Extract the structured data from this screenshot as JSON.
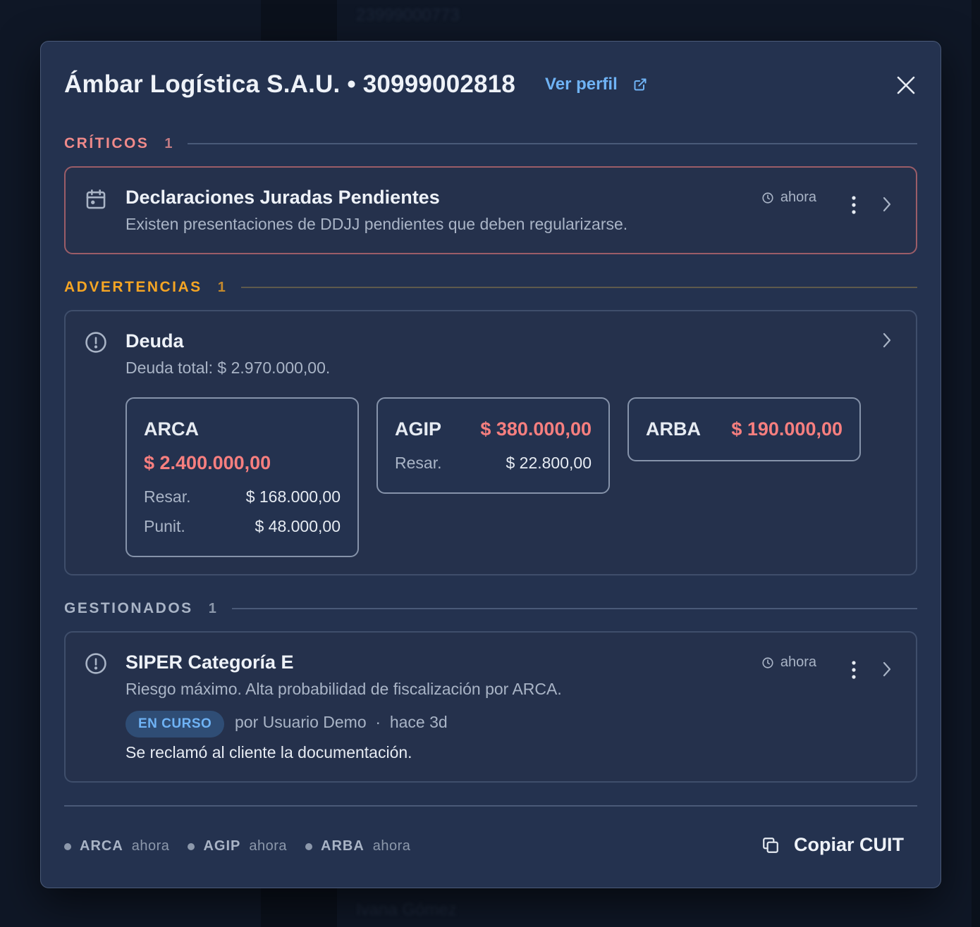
{
  "background": {
    "faint_number": "23999000773",
    "faint_name": "Ivana Gómez"
  },
  "modal": {
    "title": "Ámbar Logística S.A.U. • 30999002818",
    "profile_link": "Ver perfil"
  },
  "sections": {
    "criticos": {
      "label": "CRÍTICOS",
      "count": "1",
      "color": "#f08a8a",
      "items": [
        {
          "title": "Declaraciones Juradas Pendientes",
          "description": "Existen presentaciones de DDJJ pendientes que deben regularizarse.",
          "time": "ahora",
          "icon": "calendar-icon"
        }
      ]
    },
    "advertencias": {
      "label": "ADVERTENCIAS",
      "count": "1",
      "color": "#f5a524",
      "items": [
        {
          "title": "Deuda",
          "description": "Deuda total: $ 2.970.000,00.",
          "icon": "alert-circle-icon",
          "breakdown": [
            {
              "org": "ARCA",
              "amount": "$ 2.400.000,00",
              "rows": [
                {
                  "label": "Resar.",
                  "value": "$ 168.000,00"
                },
                {
                  "label": "Punit.",
                  "value": "$ 48.000,00"
                }
              ]
            },
            {
              "org": "AGIP",
              "amount": "$ 380.000,00",
              "rows": [
                {
                  "label": "Resar.",
                  "value": "$ 22.800,00"
                }
              ]
            },
            {
              "org": "ARBA",
              "amount": "$ 190.000,00",
              "rows": []
            }
          ]
        }
      ]
    },
    "gestionados": {
      "label": "GESTIONADOS",
      "count": "1",
      "color": "#a9b4c6",
      "items": [
        {
          "title": "SIPER Categoría E",
          "description": "Riesgo máximo. Alta probabilidad de fiscalización por ARCA.",
          "time": "ahora",
          "icon": "alert-circle-icon",
          "status_badge": "EN CURSO",
          "meta": "por Usuario Demo  ·  hace 3d",
          "note": "Se reclamó al cliente la documentación."
        }
      ]
    }
  },
  "footer": {
    "sources": [
      {
        "name": "ARCA",
        "time": "ahora"
      },
      {
        "name": "AGIP",
        "time": "ahora"
      },
      {
        "name": "ARBA",
        "time": "ahora"
      }
    ],
    "copy_button": "Copiar CUIT"
  }
}
